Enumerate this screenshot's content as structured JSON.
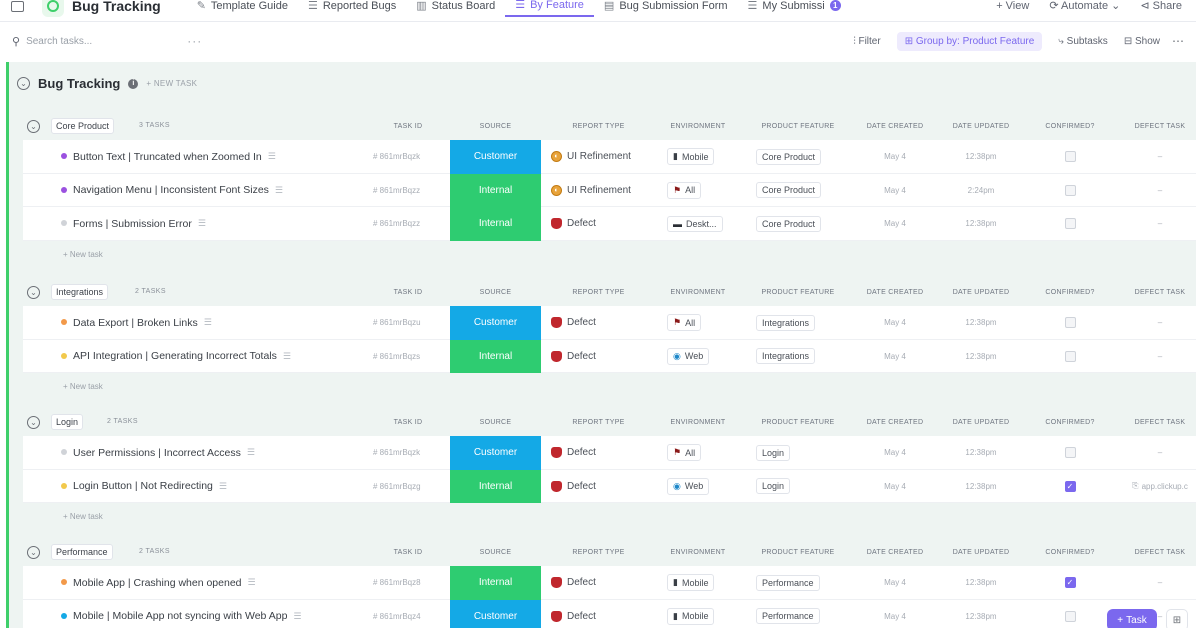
{
  "nav": {
    "title": "Bug Tracking",
    "tabs": [
      {
        "label": "Template Guide",
        "icon": "doc-icon"
      },
      {
        "label": "Reported Bugs",
        "icon": "list-icon"
      },
      {
        "label": "Status Board",
        "icon": "board-icon"
      },
      {
        "label": "By Feature",
        "icon": "list-icon",
        "active": true
      },
      {
        "label": "Bug Submission Form",
        "icon": "form-icon"
      },
      {
        "label": "My Submissi",
        "icon": "list-icon",
        "badge": "1"
      }
    ],
    "view_label": "+ View",
    "automate_label": "Automate",
    "share_label": "Share"
  },
  "toolbar": {
    "search_placeholder": "Search tasks...",
    "filter_label": "Filter",
    "group_label": "Group by: Product Feature",
    "subtasks_label": "Subtasks",
    "show_label": "Show"
  },
  "list": {
    "title": "Bug Tracking",
    "new_task": "+ NEW TASK",
    "add_task_label": "+ New task"
  },
  "columns": [
    "TASK ID",
    "SOURCE",
    "REPORT TYPE",
    "ENVIRONMENT",
    "PRODUCT FEATURE",
    "DATE CREATED",
    "DATE UPDATED",
    "CONFIRMED?",
    "DEFECT TASK"
  ],
  "groups": [
    {
      "name": "Core Product",
      "count": "3 TASKS",
      "tasks": [
        {
          "name": "Button Text | Truncated when Zoomed In",
          "dot": "#9b51e0",
          "id": "# 861mrBqzk",
          "source": "Customer",
          "source_color": "#14a9e6",
          "report": "UI Refinement",
          "report_kind": "refine",
          "env": "Mobile",
          "env_icon": "mobile-icon",
          "feature": "Core Product",
          "created": "May 4",
          "updated": "12:38pm",
          "confirmed": false,
          "defect": "–"
        },
        {
          "name": "Navigation Menu | Inconsistent Font Sizes",
          "dot": "#9b51e0",
          "id": "# 861mrBqzz",
          "source": "Internal",
          "source_color": "#2ecc71",
          "report": "UI Refinement",
          "report_kind": "refine",
          "env": "All",
          "env_icon": "flag-icon",
          "feature": "Core Product",
          "created": "May 4",
          "updated": "2:24pm",
          "confirmed": false,
          "defect": "–"
        },
        {
          "name": "Forms | Submission Error",
          "dot": "#d0d3d8",
          "id": "# 861mrBqzz",
          "source": "Internal",
          "source_color": "#2ecc71",
          "report": "Defect",
          "report_kind": "defect",
          "env": "Deskt...",
          "env_icon": "desktop-icon",
          "feature": "Core Product",
          "created": "May 4",
          "updated": "12:38pm",
          "confirmed": false,
          "defect": "–"
        }
      ]
    },
    {
      "name": "Integrations",
      "count": "2 TASKS",
      "tasks": [
        {
          "name": "Data Export | Broken Links",
          "dot": "#f2994a",
          "id": "# 861mrBqzu",
          "source": "Customer",
          "source_color": "#14a9e6",
          "report": "Defect",
          "report_kind": "defect",
          "env": "All",
          "env_icon": "flag-icon",
          "feature": "Integrations",
          "created": "May 4",
          "updated": "12:38pm",
          "confirmed": false,
          "defect": "–"
        },
        {
          "name": "API Integration | Generating Incorrect Totals",
          "dot": "#f2c94c",
          "id": "# 861mrBqzs",
          "source": "Internal",
          "source_color": "#2ecc71",
          "report": "Defect",
          "report_kind": "defect",
          "env": "Web",
          "env_icon": "globe-icon",
          "feature": "Integrations",
          "created": "May 4",
          "updated": "12:38pm",
          "confirmed": false,
          "defect": "–"
        }
      ]
    },
    {
      "name": "Login",
      "count": "2 TASKS",
      "tasks": [
        {
          "name": "User Permissions | Incorrect Access",
          "dot": "#d0d3d8",
          "id": "# 861mrBqzk",
          "source": "Customer",
          "source_color": "#14a9e6",
          "report": "Defect",
          "report_kind": "defect",
          "env": "All",
          "env_icon": "flag-icon",
          "feature": "Login",
          "created": "May 4",
          "updated": "12:38pm",
          "confirmed": false,
          "defect": "–"
        },
        {
          "name": "Login Button | Not Redirecting",
          "dot": "#f2c94c",
          "id": "# 861mrBqzg",
          "source": "Internal",
          "source_color": "#2ecc71",
          "report": "Defect",
          "report_kind": "defect",
          "env": "Web",
          "env_icon": "globe-icon",
          "feature": "Login",
          "created": "May 4",
          "updated": "12:38pm",
          "confirmed": true,
          "defect": "app.clickup.c"
        }
      ]
    },
    {
      "name": "Performance",
      "count": "2 TASKS",
      "tasks": [
        {
          "name": "Mobile App | Crashing when opened",
          "dot": "#f2994a",
          "id": "# 861mrBqz8",
          "source": "Internal",
          "source_color": "#2ecc71",
          "report": "Defect",
          "report_kind": "defect",
          "env": "Mobile",
          "env_icon": "mobile-icon",
          "feature": "Performance",
          "created": "May 4",
          "updated": "12:38pm",
          "confirmed": true,
          "defect": "–"
        },
        {
          "name": "Mobile | Mobile App not syncing with Web App",
          "dot": "#14a9e6",
          "id": "# 861mrBqz4",
          "source": "Customer",
          "source_color": "#14a9e6",
          "report": "Defect",
          "report_kind": "defect",
          "env": "Mobile",
          "env_icon": "mobile-icon",
          "feature": "Performance",
          "created": "May 4",
          "updated": "12:38pm",
          "confirmed": false,
          "defect": "–"
        }
      ]
    }
  ],
  "fab": {
    "label": "Task"
  }
}
